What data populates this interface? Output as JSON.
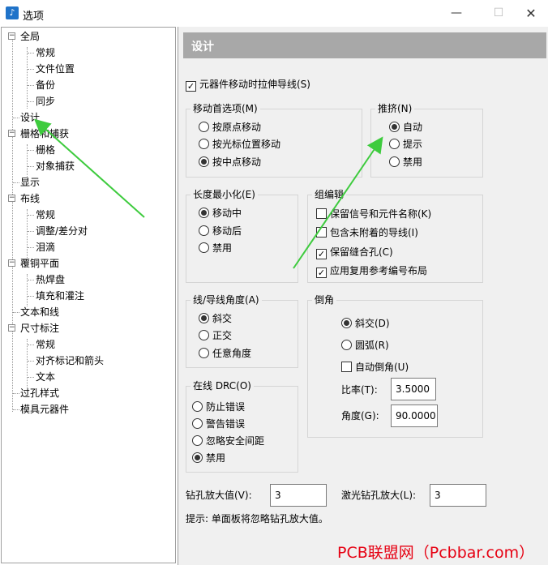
{
  "window": {
    "title": "选项",
    "minimize": "—",
    "maximize": "☐",
    "close": "✕"
  },
  "tree": {
    "nodes": [
      {
        "label": "全局",
        "expander": "−"
      },
      {
        "label": "常规"
      },
      {
        "label": "文件位置"
      },
      {
        "label": "备份"
      },
      {
        "label": "同步"
      },
      {
        "label": "设计"
      },
      {
        "label": "栅格和捕获",
        "expander": "−"
      },
      {
        "label": "栅格"
      },
      {
        "label": "对象捕获"
      },
      {
        "label": "显示"
      },
      {
        "label": "布线",
        "expander": "−"
      },
      {
        "label": "常规"
      },
      {
        "label": "调整/差分对"
      },
      {
        "label": "泪滴"
      },
      {
        "label": "覆铜平面",
        "expander": "−"
      },
      {
        "label": "热焊盘"
      },
      {
        "label": "填充和灌注"
      },
      {
        "label": "文本和线"
      },
      {
        "label": "尺寸标注",
        "expander": "−"
      },
      {
        "label": "常规"
      },
      {
        "label": "对齐标记和箭头"
      },
      {
        "label": "文本"
      },
      {
        "label": "过孔样式"
      },
      {
        "label": "模具元器件"
      }
    ]
  },
  "panel": {
    "title": "设计",
    "stretch_traces": {
      "label": "元器件移动时拉伸导线(S)",
      "checked": true
    },
    "move_pref": {
      "label": "移动首选项(M)",
      "options": [
        {
          "label": "按原点移动",
          "selected": false
        },
        {
          "label": "按光标位置移动",
          "selected": false
        },
        {
          "label": "按中点移动",
          "selected": true
        }
      ]
    },
    "push": {
      "label": "推挤(N)",
      "options": [
        {
          "label": "自动",
          "selected": true
        },
        {
          "label": "提示",
          "selected": false
        },
        {
          "label": "禁用",
          "selected": false
        }
      ]
    },
    "length_min": {
      "label": "长度最小化(E)",
      "options": [
        {
          "label": "移动中",
          "selected": true
        },
        {
          "label": "移动后",
          "selected": false
        },
        {
          "label": "禁用",
          "selected": false
        }
      ]
    },
    "group_edit": {
      "label": "组编辑",
      "options": [
        {
          "label": "保留信号和元件名称(K)",
          "checked": false
        },
        {
          "label": "包含未附着的导线(I)",
          "checked": false
        },
        {
          "label": "保留缝合孔(C)",
          "checked": true
        },
        {
          "label": "应用复用参考编号布局",
          "checked": true
        }
      ]
    },
    "line_angle": {
      "label": "线/导线角度(A)",
      "options": [
        {
          "label": "斜交",
          "selected": true
        },
        {
          "label": "正交",
          "selected": false
        },
        {
          "label": "任意角度",
          "selected": false
        }
      ]
    },
    "chamfer": {
      "label": "倒角",
      "options": [
        {
          "label": "斜交(D)",
          "selected": true
        },
        {
          "label": "圆弧(R)",
          "selected": false
        }
      ],
      "auto_chamfer": {
        "label": "自动倒角(U)",
        "checked": false
      },
      "ratio_label": "比率(T):",
      "ratio_value": "3.5000",
      "angle_label": "角度(G):",
      "angle_value": "90.0000"
    },
    "online_drc": {
      "label": "在线 DRC(O)",
      "options": [
        {
          "label": "防止错误",
          "selected": false
        },
        {
          "label": "警告错误",
          "selected": false
        },
        {
          "label": "忽略安全间距",
          "selected": false
        },
        {
          "label": "禁用",
          "selected": true
        }
      ]
    },
    "drill_oversize": {
      "label": "钻孔放大值(V):",
      "value": "3"
    },
    "laser_oversize": {
      "label": "激光钻孔放大(L):",
      "value": "3"
    },
    "hint": "提示:  单面板将忽略钻孔放大值。"
  },
  "watermark": "PCB联盟网（Pcbbar.com）",
  "accent": {
    "arrow": "#3ecb3e",
    "watermark": "#e60012",
    "header": "#a8a8a8"
  }
}
